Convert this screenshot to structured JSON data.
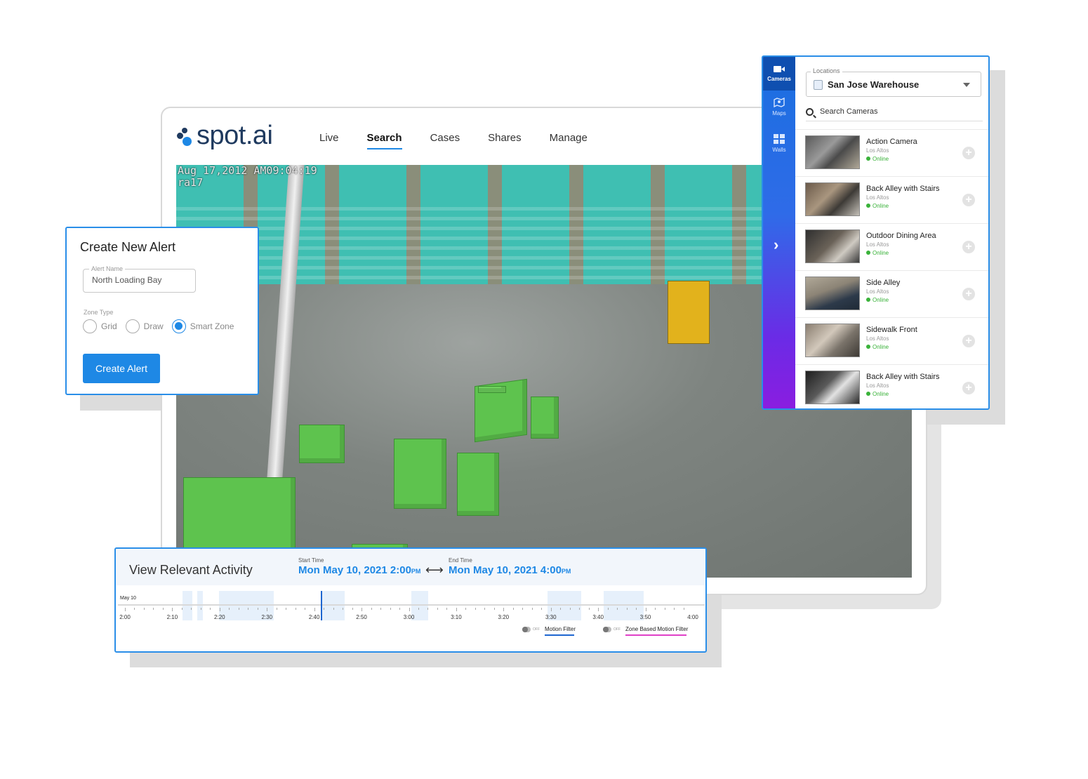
{
  "app": {
    "brand": "spot.ai",
    "nav": [
      "Live",
      "Search",
      "Cases",
      "Shares",
      "Manage"
    ],
    "active_nav": "Search"
  },
  "camera_feed": {
    "timestamp": "Aug 17,2012 AM09:04:19",
    "camera_label": "ra17"
  },
  "alert": {
    "title": "Create New Alert",
    "name_label": "Alert Name",
    "name_value": "North Loading Bay",
    "zone_type_label": "Zone Type",
    "zone_options": [
      "Grid",
      "Draw",
      "Smart Zone"
    ],
    "selected_zone": "Smart Zone",
    "button": "Create Alert"
  },
  "panel": {
    "rail": [
      {
        "label": "Cameras",
        "icon": "video-camera-icon"
      },
      {
        "label": "Maps",
        "icon": "map-icon"
      },
      {
        "label": "Walls",
        "icon": "grid-icon"
      }
    ],
    "locations_label": "Locations",
    "location": "San Jose Warehouse",
    "search_placeholder": "Search Cameras",
    "cameras": [
      {
        "name": "Action Camera",
        "location": "Los Altos",
        "status": "Online"
      },
      {
        "name": "Back Alley with Stairs",
        "location": "Los Altos",
        "status": "Online"
      },
      {
        "name": "Outdoor Dining Area",
        "location": "Los Altos",
        "status": "Online"
      },
      {
        "name": "Side Alley",
        "location": "Los Altos",
        "status": "Online"
      },
      {
        "name": "Sidewalk Front",
        "location": "Los Altos",
        "status": "Online"
      },
      {
        "name": "Back Alley with Stairs",
        "location": "Los Altos",
        "status": "Online"
      }
    ]
  },
  "activity": {
    "title": "View Relevant Activity",
    "start_label": "Start Time",
    "start_value": "Mon May 10, 2021 2:00",
    "start_ampm": "PM",
    "end_label": "End Time",
    "end_value": "Mon May 10, 2021 4:00",
    "end_ampm": "PM",
    "date_label": "May 10",
    "ticks": [
      "2:00",
      "2:10",
      "2:20",
      "2:30",
      "2:40",
      "2:50",
      "3:00",
      "3:10",
      "3:20",
      "3:30",
      "3:40",
      "3:50",
      "4:00"
    ],
    "filters": [
      {
        "state": "OFF",
        "name": "Motion Filter",
        "color": "#1e66d0"
      },
      {
        "state": "OFF",
        "name": "Zone Based Motion Filter",
        "color": "#e040c8"
      }
    ]
  },
  "colors": {
    "accent": "#1e88e5",
    "brand_navy": "#1f3a5f",
    "online": "#3ab23a"
  }
}
